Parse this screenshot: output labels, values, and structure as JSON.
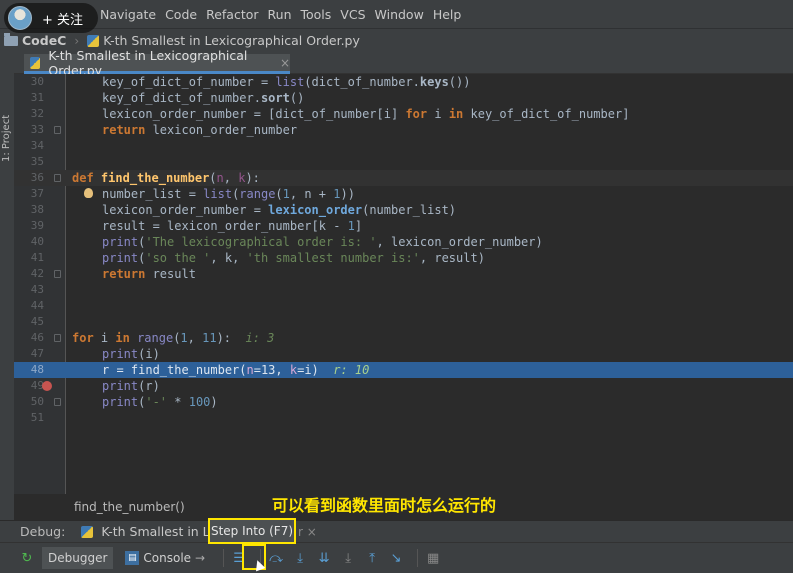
{
  "overlay": {
    "follow_label": "+ 关注",
    "annotation": "可以看到函数里面时怎么运行的"
  },
  "menu": [
    "Navigate",
    "Code",
    "Refactor",
    "Run",
    "Tools",
    "VCS",
    "Window",
    "Help"
  ],
  "breadcrumb": {
    "project": "CodeC",
    "file": "K-th Smallest in Lexicographical Order.py"
  },
  "sidebar": {
    "project_label": "1: Project"
  },
  "editor_tab": {
    "title": "K-th Smallest in Lexicographical Order.py",
    "close": "×"
  },
  "code_lines": [
    {
      "n": "30"
    },
    {
      "n": "31"
    },
    {
      "n": "32"
    },
    {
      "n": "33"
    },
    {
      "n": "34"
    },
    {
      "n": "35"
    },
    {
      "n": "36"
    },
    {
      "n": "37"
    },
    {
      "n": "38"
    },
    {
      "n": "39"
    },
    {
      "n": "40"
    },
    {
      "n": "41"
    },
    {
      "n": "42"
    },
    {
      "n": "43"
    },
    {
      "n": "44"
    },
    {
      "n": "45"
    },
    {
      "n": "46"
    },
    {
      "n": "47"
    },
    {
      "n": "48"
    },
    {
      "n": "49"
    },
    {
      "n": "50"
    },
    {
      "n": "51"
    }
  ],
  "code_text": {
    "l30": "key_of_dict_of_number = ",
    "l30b": "list",
    "l30c": "(dict_of_number.",
    "l30d": "keys",
    "l30e": "())",
    "l31a": "key_of_dict_of_number.",
    "l31b": "sort",
    "l31c": "()",
    "l32a": "lexicon_order_number = [dict_of_number[i] ",
    "l32b": "for",
    "l32c": " i ",
    "l32d": "in",
    "l32e": " key_of_dict_of_number]",
    "l33a": "return",
    "l33b": " lexicon_order_number",
    "l36a": "def",
    "l36b": "find_the_number",
    "l36c": "(",
    "l36d": "n",
    "l36e": ", ",
    "l36f": "k",
    "l36g": "):",
    "l37a": "number_list = ",
    "l37b": "list",
    "l37c": "(",
    "l37d": "range",
    "l37e": "(",
    "l37f": "1",
    "l37g": ", n + ",
    "l37h": "1",
    "l37i": "))",
    "l38a": "lexicon_order_number = ",
    "l38b": "lexicon_order",
    "l38c": "(number_list)",
    "l39a": "result = lexicon_order_number[k - ",
    "l39b": "1",
    "l39c": "]",
    "l40a": "print",
    "l40b": "(",
    "l40c": "'The lexicographical order is: '",
    "l40d": ", lexicon_order_number)",
    "l41a": "print",
    "l41b": "(",
    "l41c": "'so the '",
    "l41d": ", k, ",
    "l41e": "'th smallest number is:'",
    "l41f": ", result)",
    "l42a": "return",
    "l42b": " result",
    "l46a": "for",
    "l46b": " i ",
    "l46c": "in",
    "l46d": " ",
    "l46e": "range",
    "l46f": "(",
    "l46g": "1",
    "l46h": ", ",
    "l46i": "11",
    "l46j": "):",
    "l46k": "  i: 3",
    "l47a": "print",
    "l47b": "(i)",
    "l48a": "r = find_the_number(",
    "l48b": "n",
    "l48c": "=13, ",
    "l48d": "k",
    "l48e": "=i)",
    "l48f": "  r: 10",
    "l49a": "print",
    "l49b": "(r)",
    "l50a": "print",
    "l50b": "(",
    "l50c": "'-'",
    "l50d": " * ",
    "l50e": "100",
    "l50f": ")"
  },
  "editor_footer": "find_the_number()",
  "debug": {
    "label": "Debug:",
    "session_tab": "K-th Smallest in Lexic",
    "tooltip": "Step Into (F7)",
    "tooltip_tail": "r ×",
    "debugger_tab": "Debugger",
    "console_tab": "Console"
  },
  "colors": {
    "accent": "#4a88c7",
    "exec_line": "#2d6099",
    "highlight_box": "#ffe600",
    "breakpoint": "#c75450"
  }
}
